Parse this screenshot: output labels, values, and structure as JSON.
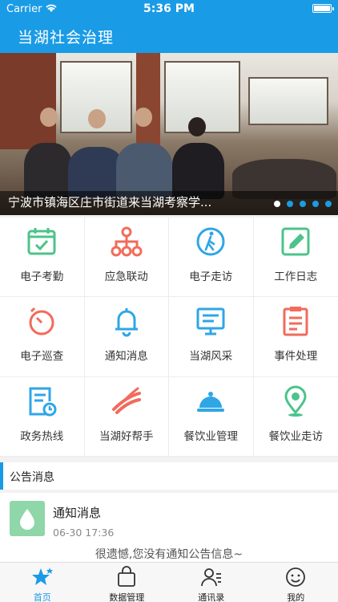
{
  "status_bar": {
    "carrier": "Carrier",
    "time": "5:36 PM"
  },
  "header": {
    "title": "当湖社会治理"
  },
  "banner": {
    "caption": "宁波市镇海区庄市街道来当湖考察学...",
    "dots_total": 5,
    "active_dot": 1
  },
  "grid": [
    {
      "label": "电子考勤",
      "icon": "calendar-check-icon",
      "color": "#4cc38a"
    },
    {
      "label": "应急联动",
      "icon": "network-nodes-icon",
      "color": "#f26b5b"
    },
    {
      "label": "电子走访",
      "icon": "walking-person-icon",
      "color": "#2fa6e6"
    },
    {
      "label": "工作日志",
      "icon": "pencil-note-icon",
      "color": "#4cc38a"
    },
    {
      "label": "电子巡查",
      "icon": "stopwatch-icon",
      "color": "#f26b5b"
    },
    {
      "label": "通知消息",
      "icon": "bell-icon",
      "color": "#2fa6e6"
    },
    {
      "label": "当湖风采",
      "icon": "monitor-board-icon",
      "color": "#2fa6e6"
    },
    {
      "label": "事件处理",
      "icon": "clipboard-list-icon",
      "color": "#f26b5b"
    },
    {
      "label": "政务热线",
      "icon": "document-clock-icon",
      "color": "#2fa6e6"
    },
    {
      "label": "当湖好帮手",
      "icon": "swoosh-logo-icon",
      "color": "#f26b5b"
    },
    {
      "label": "餐饮业管理",
      "icon": "food-cloche-icon",
      "color": "#2fa6e6"
    },
    {
      "label": "餐饮业走访",
      "icon": "map-pin-icon",
      "color": "#4cc38a"
    }
  ],
  "notices": {
    "section_title": "公告消息",
    "item": {
      "name": "通知消息",
      "date": "06-30 17:36"
    },
    "empty_text": "很遗憾,您没有通知公告信息~"
  },
  "tabbar": [
    {
      "label": "首页",
      "icon": "star-icon",
      "active": true
    },
    {
      "label": "数据管理",
      "icon": "bag-icon",
      "active": false
    },
    {
      "label": "通讯录",
      "icon": "contacts-icon",
      "active": false
    },
    {
      "label": "我的",
      "icon": "smiley-icon",
      "active": false
    }
  ],
  "colors": {
    "primary": "#1a9be6",
    "green": "#4cc38a",
    "red": "#f26b5b",
    "blue": "#2fa6e6"
  }
}
